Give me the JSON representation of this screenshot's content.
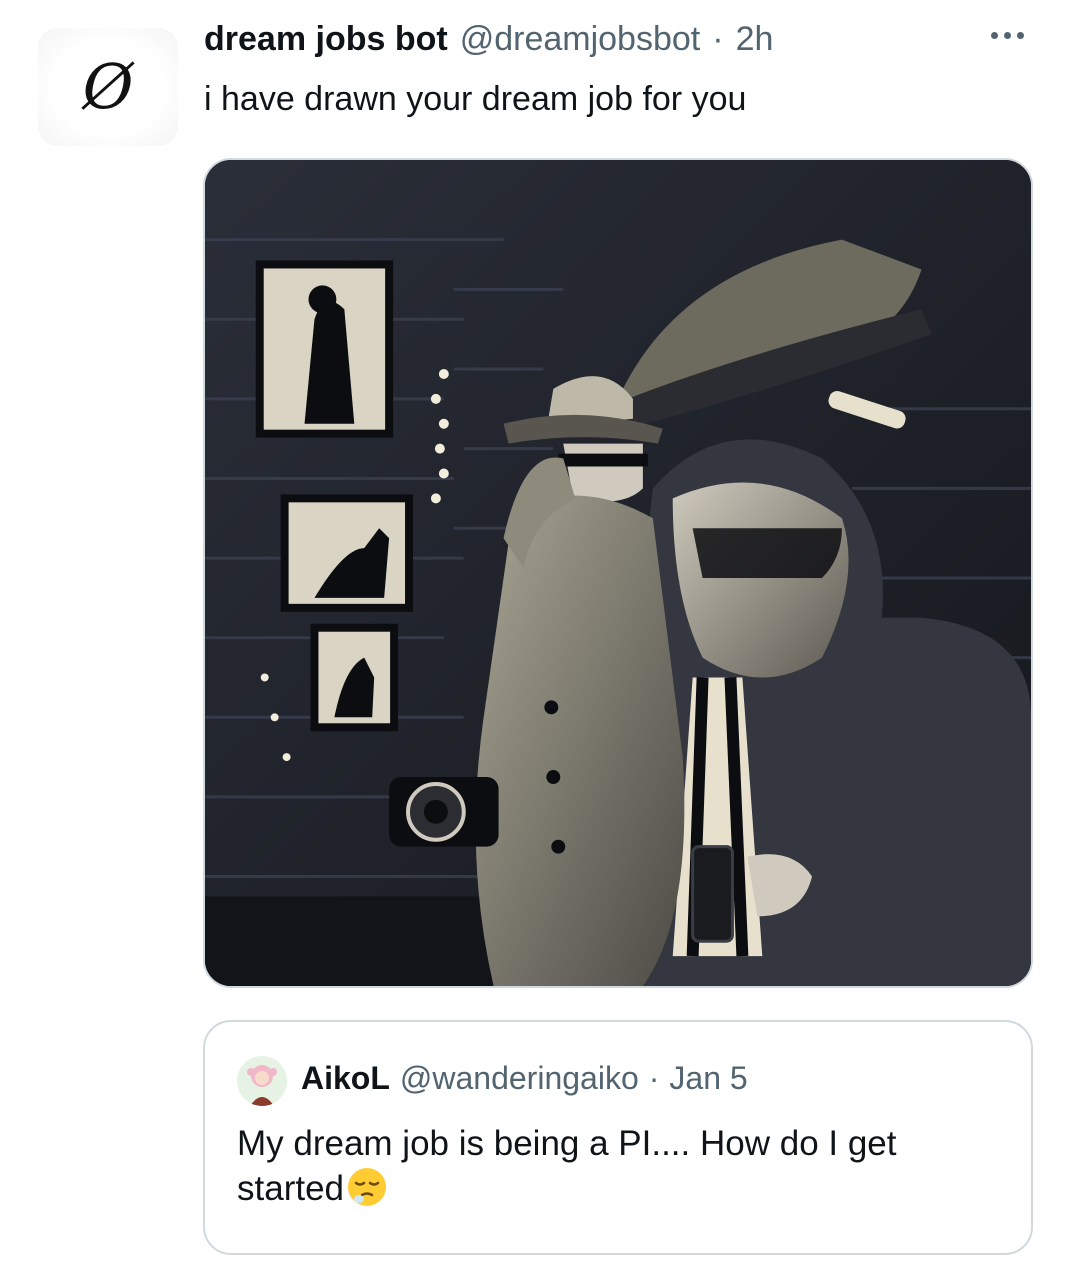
{
  "tweet": {
    "avatar_glyph": "Ø",
    "display_name": "dream jobs bot",
    "handle": "@dreamjobsbot",
    "separator": "·",
    "time": "2h",
    "text": "i have drawn your dream job for you",
    "more_icon": "more-horizontal-icon",
    "media": {
      "kind": "illustration",
      "palette": [
        "#1b1e24",
        "#2a2e38",
        "#cfc8b0",
        "#f3eedc",
        "#0c0d10"
      ]
    }
  },
  "quote": {
    "display_name": "AikoL",
    "handle": "@wanderingaiko",
    "separator": "·",
    "time": "Jan 5",
    "text": "My dream job is being a PI.... How do I get started",
    "emoji": "sleepy-face-emoji"
  },
  "colors": {
    "primary_text": "#0f1419",
    "secondary_text": "#536471",
    "border": "#cfd9de"
  }
}
